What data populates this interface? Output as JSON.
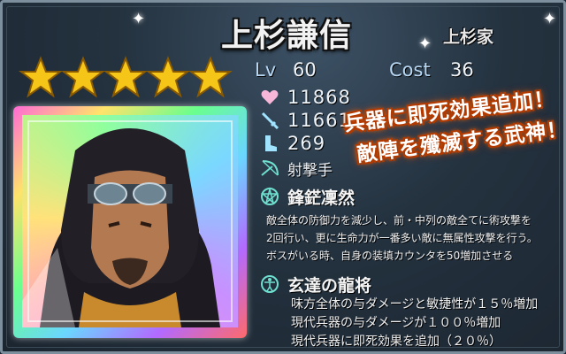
{
  "unit": {
    "name": "上杉謙信",
    "clan": "上杉家",
    "rarity_stars": 5,
    "level_label": "Lv",
    "level": "60",
    "cost_label": "Cost",
    "cost": "36",
    "hp": "11868",
    "attack": "11661",
    "speed": "269",
    "unit_type": "射撃手"
  },
  "skill": {
    "name": "鋒鋩凜然",
    "description": [
      "敵全体の防御力を減少し、前・中列の敵全てに術攻撃を",
      "2回行い、更に生命力が一番多い敵に無属性攻撃を行う。",
      "ボスがいる時、自身の装填カウンタを50増加させる"
    ]
  },
  "leader_skill": {
    "name": "玄達の龍将",
    "description": [
      "味方全体の与ダメージと敏捷性が１５％増加",
      "現代兵器の与ダメージが１００％増加",
      "現代兵器に即死効果を追加（２０％）"
    ]
  },
  "banner": {
    "line1": "兵器に即死効果追加！",
    "line2": "敵陣を殲滅する武神！"
  },
  "colors": {
    "star": "#f5c518",
    "accent_label": "#b8d8f4",
    "banner_glow": "#ff7a00",
    "icon_color": "#9fe3ff"
  }
}
